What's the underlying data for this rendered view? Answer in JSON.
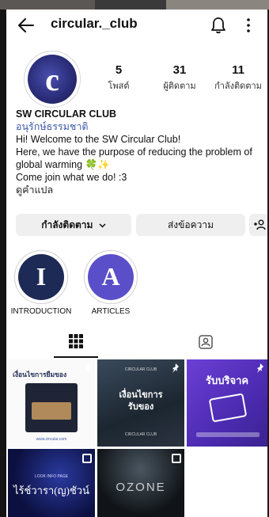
{
  "header": {
    "username": "circular._club",
    "icons": [
      "back-arrow-icon",
      "bell-icon",
      "more-vertical-icon"
    ]
  },
  "profile": {
    "avatar_letter": "c",
    "stats": [
      {
        "num": "5",
        "label": "โพสต์"
      },
      {
        "num": "31",
        "label": "ผู้ติดตาม"
      },
      {
        "num": "11",
        "label": "กำลังติดตาม"
      }
    ]
  },
  "bio": {
    "name": "SW CIRCULAR CLUB",
    "category": "อนุรักษ์ธรรมชาติ",
    "line1": "Hi! Welcome to the SW Circular Club!",
    "line2": "Here, we have the purpose of reducing the problem of global warming 🍀✨",
    "line3": "Come join what we do! :3",
    "translate": "ดูคำแปล"
  },
  "buttons": {
    "following": "กำลังติดตาม",
    "message": "ส่งข้อความ",
    "add_person_icon": "add-person-icon"
  },
  "highlights": [
    {
      "letter": "I",
      "label": "INTRODUCTION",
      "color": "#1d2a55"
    },
    {
      "letter": "A",
      "label": "ARTICLES",
      "color": "#5a4fc8"
    }
  ],
  "tabs": [
    "grid-icon",
    "tagged-icon"
  ],
  "posts": [
    {
      "title": "เงื่อนไขการยืมของ",
      "caption": "www.circular.com"
    },
    {
      "title": "เงื่อนไขการ\nรับของ",
      "caption": "CIRCULAR CLUB"
    },
    {
      "title": "รับบริจาค",
      "caption": ""
    },
    {
      "title": "ไร้ช์วารา(ญ)ชัวน์",
      "caption": "LOOK INFO PAGE"
    },
    {
      "title": "OZONE",
      "caption": ""
    }
  ],
  "colors": {
    "accent_blue": "#3c58a8",
    "button_bg": "#efefef",
    "purple": "#5a4fc8",
    "navy": "#1d2a55"
  }
}
